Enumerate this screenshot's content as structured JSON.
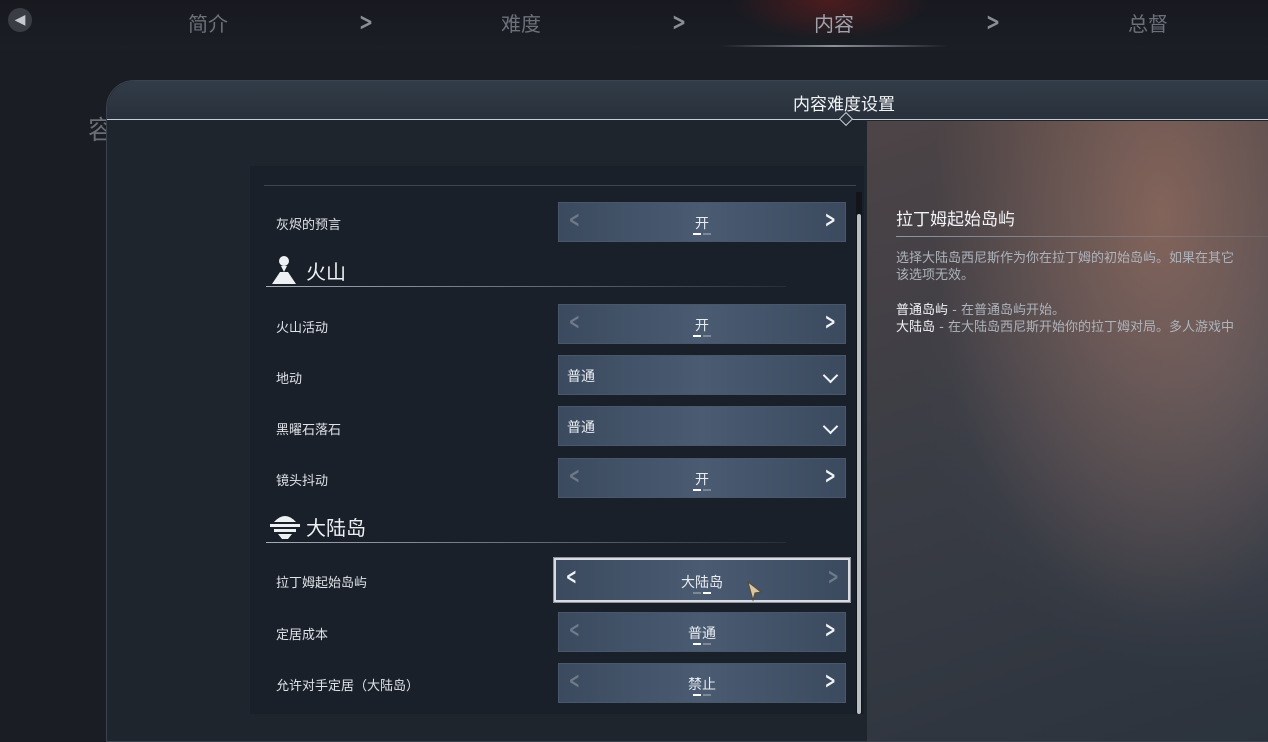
{
  "nav": {
    "steps": [
      "简介",
      "难度",
      "内容",
      "总督"
    ],
    "active_step": "内容"
  },
  "background": {
    "partial_label": "容"
  },
  "panel": {
    "title": "内容难度设置"
  },
  "settings": {
    "ash_prophecy": {
      "label": "灰烬的预言",
      "value": "开"
    },
    "volcano_section": {
      "title": "火山",
      "icon": "volcano-icon"
    },
    "volcano_activity": {
      "label": "火山活动",
      "value": "开"
    },
    "earthquake": {
      "label": "地动",
      "value": "普通"
    },
    "obsidian_rockfall": {
      "label": "黑曜石落石",
      "value": "普通"
    },
    "camera_shake": {
      "label": "镜头抖动",
      "value": "开"
    },
    "mainland_section": {
      "title": "大陆岛",
      "icon": "mainland-island-icon"
    },
    "latium_start_island": {
      "label": "拉丁姆起始岛屿",
      "value": "大陆岛"
    },
    "settlement_cost": {
      "label": "定居成本",
      "value": "普通"
    },
    "allow_rival_settle": {
      "label": "允许对手定居（大陆岛）",
      "value": "禁止"
    }
  },
  "description": {
    "title": "拉丁姆起始岛屿",
    "line1": "选择大陆岛西尼斯作为你在拉丁姆的初始岛屿。如果在其它",
    "line2": "该选项无效。",
    "option1_name": "普通岛屿",
    "option1_text": " - 在普通岛屿开始。",
    "option2_name": "大陆岛",
    "option2_text": " - 在大陆岛西尼斯开始你的拉丁姆对局。多人游戏中"
  },
  "colors": {
    "accent": "#d9dde3",
    "control_bg": "#4a5b72"
  }
}
